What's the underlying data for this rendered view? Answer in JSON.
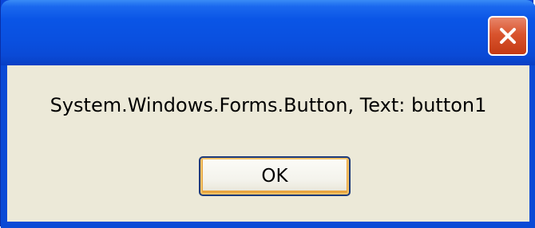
{
  "window": {
    "title": ""
  },
  "dialog": {
    "message": "System.Windows.Forms.Button, Text: button1",
    "ok_label": "OK"
  },
  "icons": {
    "close": "close-icon"
  },
  "colors": {
    "titlebar_blue": "#0a50e0",
    "close_red": "#d9542e",
    "client_bg": "#ece9d8",
    "button_focus_orange": "#f2c268"
  }
}
